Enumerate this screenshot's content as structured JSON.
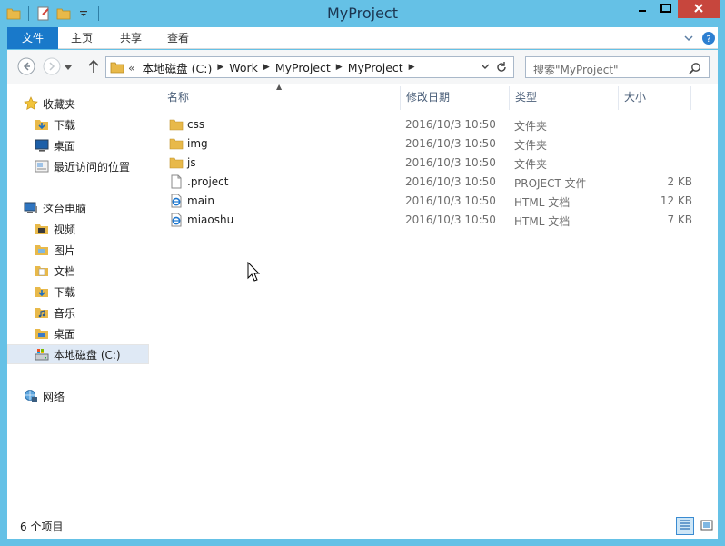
{
  "window": {
    "title": "MyProject",
    "minimize_icon": "minimize-icon",
    "maximize_icon": "maximize-icon",
    "close_icon": "close-icon"
  },
  "ribbon": {
    "tabs": [
      {
        "label": "文件"
      },
      {
        "label": "主页"
      },
      {
        "label": "共享"
      },
      {
        "label": "查看"
      }
    ]
  },
  "address": {
    "overflow": "«",
    "crumbs": [
      "本地磁盘 (C:)",
      "Work",
      "MyProject",
      "MyProject"
    ]
  },
  "search": {
    "placeholder": "搜索\"MyProject\""
  },
  "sidebar": {
    "favorites_label": "收藏夹",
    "favorites": [
      {
        "label": "下载"
      },
      {
        "label": "桌面"
      },
      {
        "label": "最近访问的位置"
      }
    ],
    "pc_label": "这台电脑",
    "pc_items": [
      {
        "label": "视频"
      },
      {
        "label": "图片"
      },
      {
        "label": "文档"
      },
      {
        "label": "下载"
      },
      {
        "label": "音乐"
      },
      {
        "label": "桌面"
      },
      {
        "label": "本地磁盘 (C:)"
      }
    ],
    "network_label": "网络"
  },
  "columns": {
    "name": "名称",
    "date": "修改日期",
    "type": "类型",
    "size": "大小"
  },
  "files": [
    {
      "name": "css",
      "date": "2016/10/3 10:50",
      "type": "文件夹",
      "size": ""
    },
    {
      "name": "img",
      "date": "2016/10/3 10:50",
      "type": "文件夹",
      "size": ""
    },
    {
      "name": "js",
      "date": "2016/10/3 10:50",
      "type": "文件夹",
      "size": ""
    },
    {
      "name": ".project",
      "date": "2016/10/3 10:50",
      "type": "PROJECT 文件",
      "size": "2 KB"
    },
    {
      "name": "main",
      "date": "2016/10/3 10:50",
      "type": "HTML 文档",
      "size": "12 KB"
    },
    {
      "name": "miaoshu",
      "date": "2016/10/3 10:50",
      "type": "HTML 文档",
      "size": "7 KB"
    }
  ],
  "status": {
    "item_count": "6 个项目"
  },
  "colors": {
    "titlebar": "#65c1e6",
    "file_tab": "#1979ca",
    "close_button": "#c7463d",
    "folder": "#e8b94a",
    "selected": "#dfe9f5"
  }
}
